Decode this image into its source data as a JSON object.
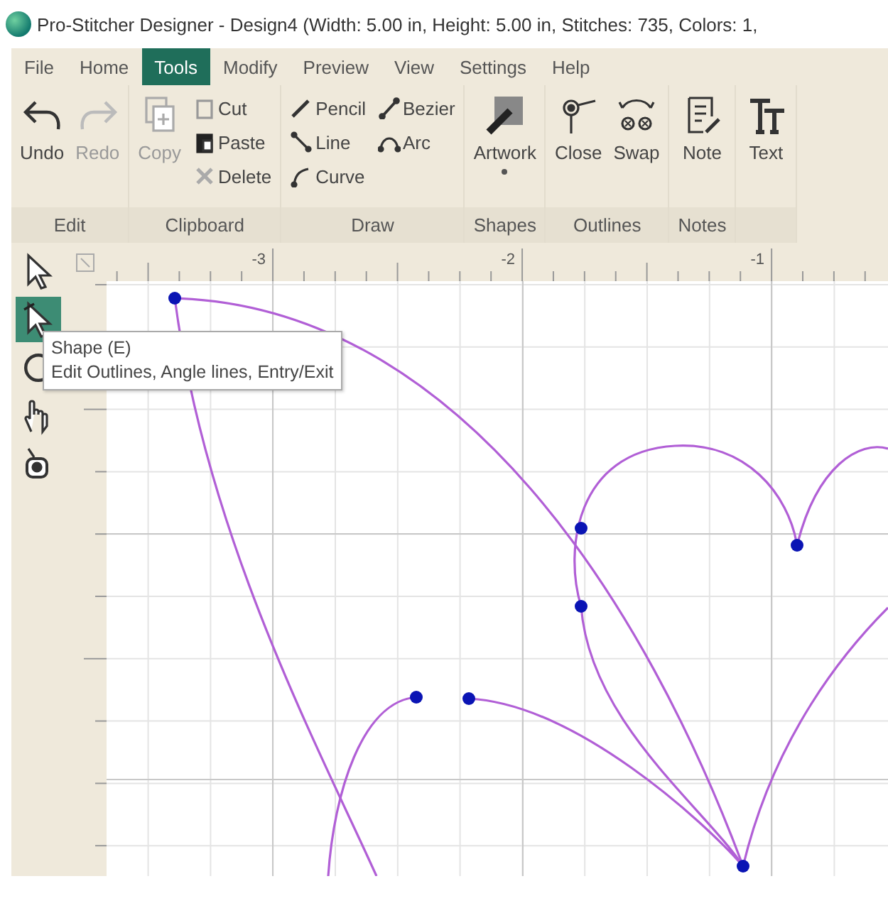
{
  "window": {
    "title": "Pro-Stitcher Designer - Design4 (Width: 5.00 in, Height: 5.00 in, Stitches: 735, Colors: 1,"
  },
  "menu": [
    {
      "label": "File",
      "selected": false
    },
    {
      "label": "Home",
      "selected": false
    },
    {
      "label": "Tools",
      "selected": true
    },
    {
      "label": "Modify",
      "selected": false
    },
    {
      "label": "Preview",
      "selected": false
    },
    {
      "label": "View",
      "selected": false
    },
    {
      "label": "Settings",
      "selected": false
    },
    {
      "label": "Help",
      "selected": false
    }
  ],
  "ribbon": [
    {
      "label": "Edit",
      "tools": [
        {
          "label": "Undo",
          "kind": "large",
          "disabled": false
        },
        {
          "label": "Redo",
          "kind": "large",
          "disabled": true
        }
      ]
    },
    {
      "label": "Clipboard",
      "tools": [
        {
          "label": "Copy",
          "kind": "large",
          "disabled": true
        },
        {
          "label": "Cut",
          "kind": "small",
          "disabled": false
        },
        {
          "label": "Paste",
          "kind": "small",
          "disabled": false
        },
        {
          "label": "Delete",
          "kind": "small",
          "disabled": false
        }
      ]
    },
    {
      "label": "Draw",
      "tools": [
        {
          "label": "Pencil",
          "kind": "small",
          "disabled": false
        },
        {
          "label": "Line",
          "kind": "small",
          "disabled": false
        },
        {
          "label": "Curve",
          "kind": "small",
          "disabled": false
        },
        {
          "label": "Bezier",
          "kind": "small",
          "disabled": false
        },
        {
          "label": "Arc",
          "kind": "small",
          "disabled": false
        }
      ]
    },
    {
      "label": "Shapes",
      "tools": [
        {
          "label": "Artwork",
          "kind": "dropdown",
          "disabled": false
        }
      ]
    },
    {
      "label": "Outlines",
      "tools": [
        {
          "label": "Close",
          "kind": "large",
          "disabled": false
        },
        {
          "label": "Swap",
          "kind": "large",
          "disabled": false
        }
      ]
    },
    {
      "label": "Notes",
      "tools": [
        {
          "label": "Note",
          "kind": "large",
          "disabled": false
        }
      ]
    },
    {
      "tools": [
        {
          "label": "Text",
          "kind": "large",
          "disabled": false
        }
      ]
    }
  ],
  "ruler": {
    "labels": [
      "-3",
      "-2",
      "-1"
    ]
  },
  "left_tools": [
    {
      "selected": false
    },
    {
      "selected": true
    },
    {
      "selected": false
    },
    {
      "selected": false
    },
    {
      "selected": false
    }
  ],
  "tooltip": {
    "title": "Shape (E)",
    "text": "Edit Outlines, Angle lines, Entry/Exit"
  }
}
